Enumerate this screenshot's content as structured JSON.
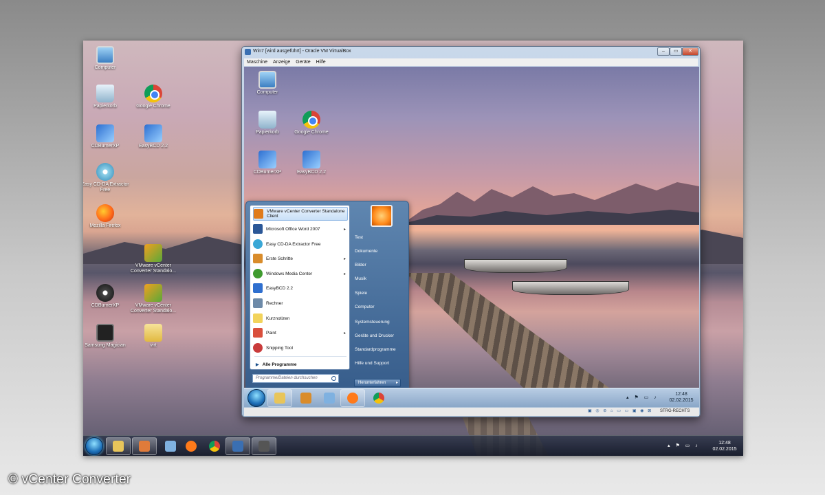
{
  "host": {
    "desktop_icons": [
      {
        "label": "Computer",
        "icon": "computer-icon"
      },
      {
        "label": "Papierkorb",
        "icon": "recycle-bin-icon"
      },
      {
        "label": "Google Chrome",
        "icon": "chrome-icon"
      },
      {
        "label": "CDBurnerXP",
        "icon": "setup-icon"
      },
      {
        "label": "EasyBCD 2.2",
        "icon": "setup-icon"
      },
      {
        "label": "Easy CD-DA Extractor Free",
        "icon": "cd-icon"
      },
      {
        "label": "Mozilla Firefox",
        "icon": "firefox-icon"
      },
      {
        "label": "VMware vCenter Converter Standalo...",
        "icon": "vmware-icon"
      },
      {
        "label": "CDBurnerXP",
        "icon": "cd-burn-icon"
      },
      {
        "label": "VMware vCenter Converter Standalo...",
        "icon": "vmware-icon"
      },
      {
        "label": "Samsung Magician",
        "icon": "samsung-icon"
      },
      {
        "label": "virt",
        "icon": "folder-icon"
      }
    ],
    "taskbar": {
      "clock_time": "12:48",
      "clock_date": "02.02.2015"
    }
  },
  "vm": {
    "title": "Win7 [wird ausgeführt] - Oracle VM VirtualBox",
    "menu": [
      "Maschine",
      "Anzeige",
      "Geräte",
      "Hilfe"
    ],
    "desktop_icons": [
      {
        "label": "Computer",
        "icon": "computer-icon"
      },
      {
        "label": "Papierkorb",
        "icon": "recycle-bin-icon"
      },
      {
        "label": "Google Chrome",
        "icon": "chrome-icon"
      },
      {
        "label": "CDBurnerXP",
        "icon": "setup-icon"
      },
      {
        "label": "EasyBCD 2.2",
        "icon": "setup-icon"
      }
    ],
    "start_menu": {
      "programs": [
        {
          "label": "VMware vCenter Converter Standalone Client",
          "submenu": false,
          "color": "#e07b1a"
        },
        {
          "label": "Microsoft Office Word 2007",
          "submenu": true,
          "color": "#2b5797"
        },
        {
          "label": "Easy CD-DA Extractor Free",
          "submenu": false,
          "color": "#3aa7d6"
        },
        {
          "label": "Erste Schritte",
          "submenu": true,
          "color": "#d98c2b"
        },
        {
          "label": "Windows Media Center",
          "submenu": true,
          "color": "#3f9b2f"
        },
        {
          "label": "EasyBCD 2.2",
          "submenu": false,
          "color": "#2f6fcf"
        },
        {
          "label": "Rechner",
          "submenu": false,
          "color": "#6d8aa8"
        },
        {
          "label": "Kurznotizen",
          "submenu": false,
          "color": "#f2d35c"
        },
        {
          "label": "Paint",
          "submenu": true,
          "color": "#d94f3c"
        },
        {
          "label": "Snipping Tool",
          "submenu": false,
          "color": "#c93b3b"
        }
      ],
      "all_programs": "Alle Programme",
      "search_placeholder": "Programme/Dateien durchsuchen",
      "right_items": [
        "Test",
        "Dokumente",
        "Bilder",
        "Musik",
        "Spiele",
        "Computer",
        "Systemsteuerung",
        "Geräte und Drucker",
        "Standardprogramme",
        "Hilfe und Support"
      ],
      "shutdown_label": "Herunterfahren"
    },
    "taskbar": {
      "clock_time": "12:48",
      "clock_date": "02.02.2015"
    },
    "status_bar": {
      "host_key": "STRG-RECHTS"
    }
  },
  "copyright": "© vCenter Converter"
}
